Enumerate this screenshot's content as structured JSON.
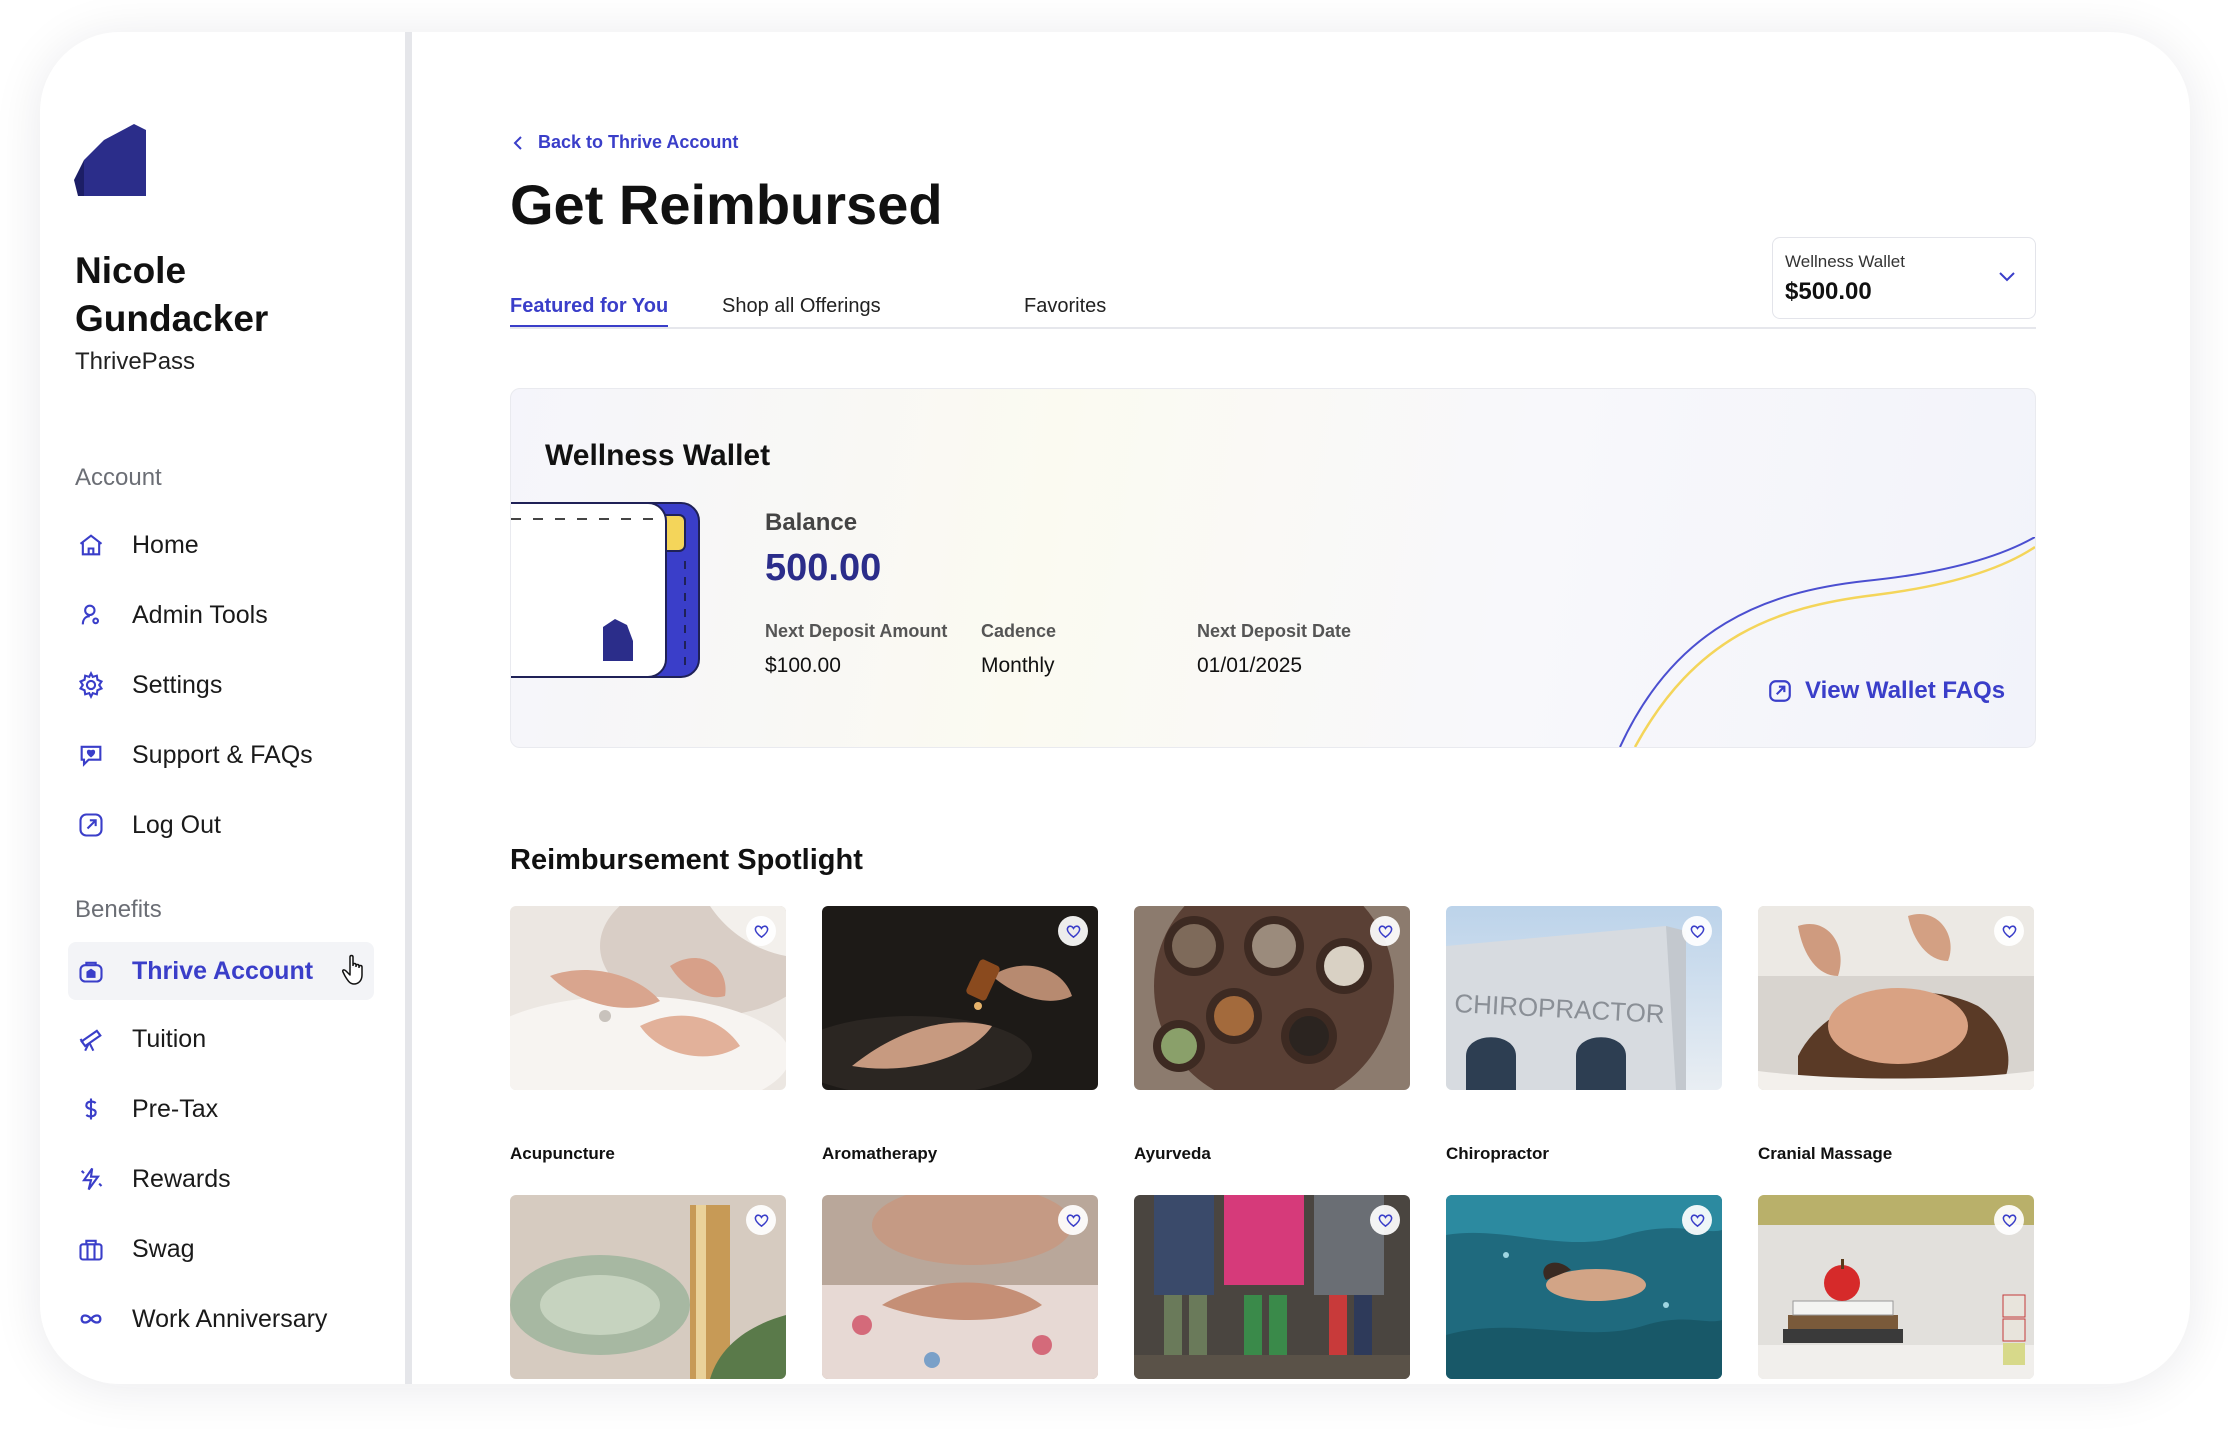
{
  "user": {
    "name": "Nicole Gundacker",
    "company": "ThrivePass"
  },
  "sidebar": {
    "account_label": "Account",
    "account_items": [
      {
        "label": "Home",
        "icon": "home-icon"
      },
      {
        "label": "Admin Tools",
        "icon": "admin-icon"
      },
      {
        "label": "Settings",
        "icon": "gear-icon"
      },
      {
        "label": "Support & FAQs",
        "icon": "support-icon"
      },
      {
        "label": "Log Out",
        "icon": "logout-icon"
      }
    ],
    "benefits_label": "Benefits",
    "benefit_items": [
      {
        "label": "Thrive Account",
        "icon": "thrive-account-icon",
        "active": true
      },
      {
        "label": "Tuition",
        "icon": "telescope-icon"
      },
      {
        "label": "Pre-Tax",
        "icon": "dollar-icon"
      },
      {
        "label": "Rewards",
        "icon": "rewards-icon"
      },
      {
        "label": "Swag",
        "icon": "swag-icon"
      },
      {
        "label": "Work Anniversary",
        "icon": "infinity-icon"
      }
    ]
  },
  "main": {
    "back_link": "Back to Thrive Account",
    "title": "Get Reimbursed",
    "tabs": [
      {
        "label": "Featured for You",
        "active": true
      },
      {
        "label": "Shop all Offerings"
      },
      {
        "label": "Favorites"
      }
    ],
    "wallet_select": {
      "label": "Wellness Wallet",
      "value": "$500.00"
    }
  },
  "wallet_card": {
    "title": "Wellness Wallet",
    "balance_label": "Balance",
    "balance": "500.00",
    "next_deposit_amount_label": "Next Deposit Amount",
    "next_deposit_amount": "$100.00",
    "cadence_label": "Cadence",
    "cadence": "Monthly",
    "next_deposit_date_label": "Next Deposit Date",
    "next_deposit_date": "01/01/2025",
    "faq_link": "View Wallet FAQs"
  },
  "spotlight": {
    "title": "Reimbursement Spotlight",
    "row1": [
      {
        "label": "Acupuncture"
      },
      {
        "label": "Aromatherapy"
      },
      {
        "label": "Ayurveda"
      },
      {
        "label": "Chiropractor",
        "sign": "CHIROPRACTOR"
      },
      {
        "label": "Cranial Massage"
      }
    ],
    "row2": [
      {
        "label": ""
      },
      {
        "label": ""
      },
      {
        "label": ""
      },
      {
        "label": ""
      },
      {
        "label": ""
      }
    ]
  },
  "colors": {
    "accent": "#3a3ec9",
    "brand_dark": "#2b2d8a",
    "yellow": "#f4d55a"
  }
}
